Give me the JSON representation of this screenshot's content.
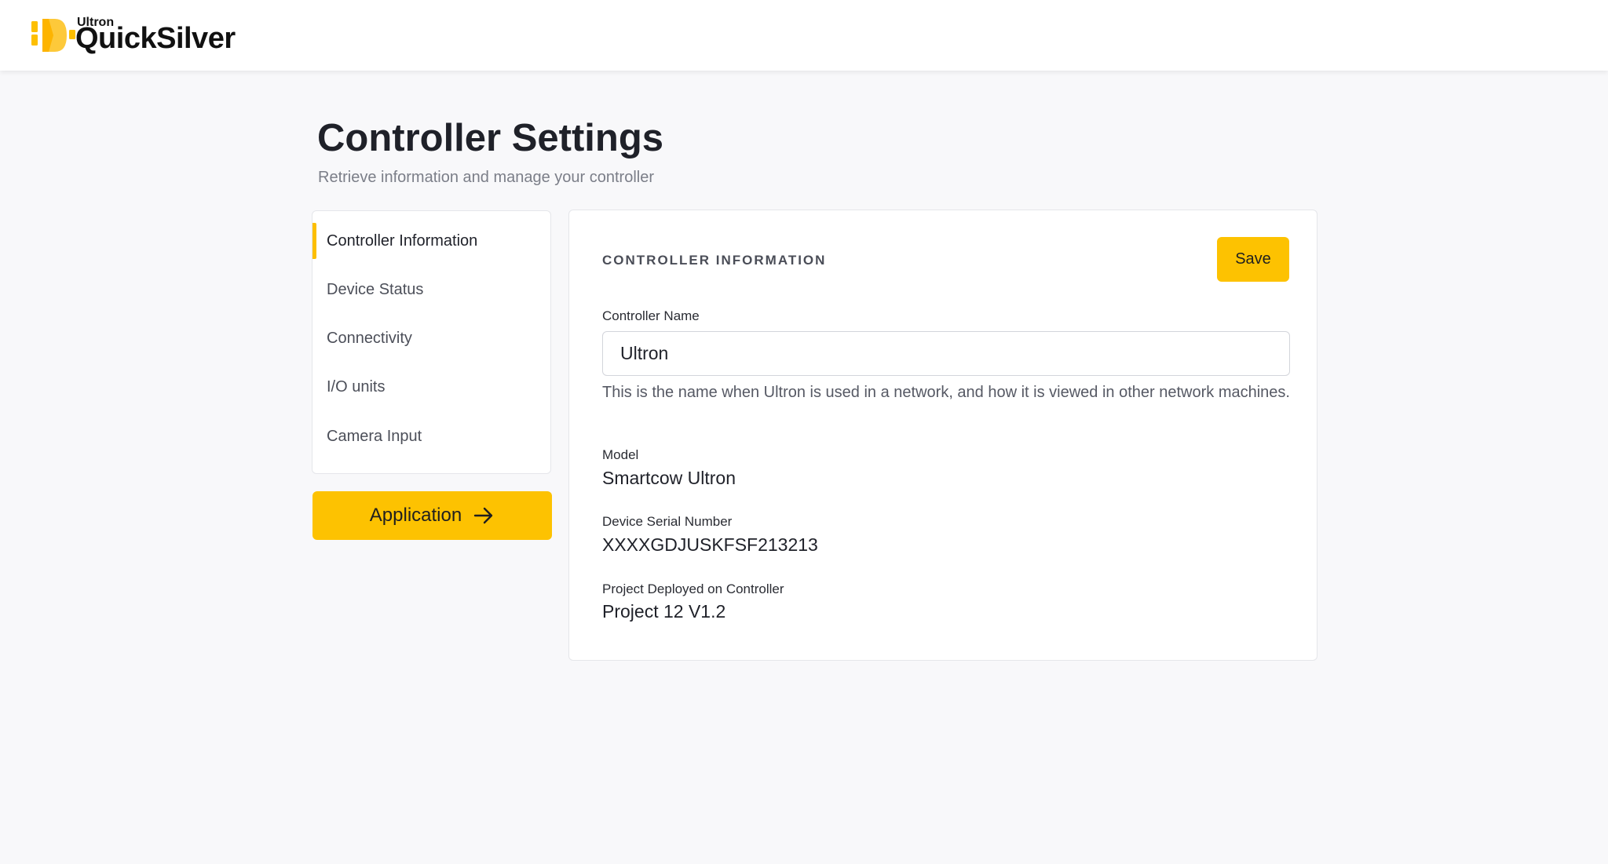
{
  "brand": {
    "small": "Ultron",
    "big": "QuickSilver",
    "accent": "#fdc201"
  },
  "page": {
    "title": "Controller Settings",
    "subtitle": "Retrieve information and manage your controller"
  },
  "sidebar": {
    "items": [
      {
        "label": "Controller Information",
        "active": true
      },
      {
        "label": "Device Status",
        "active": false
      },
      {
        "label": "Connectivity",
        "active": false
      },
      {
        "label": "I/O units",
        "active": false
      },
      {
        "label": "Camera Input",
        "active": false
      }
    ],
    "application_button": "Application"
  },
  "panel": {
    "section_title": "CONTROLLER INFORMATION",
    "save_label": "Save",
    "controller_name": {
      "label": "Controller Name",
      "value": "Ultron",
      "help": "This is the name when Ultron is used in a network, and how it is viewed in other network machines."
    },
    "model": {
      "label": "Model",
      "value": "Smartcow Ultron"
    },
    "serial": {
      "label": "Device Serial Number",
      "value": "XXXXGDJUSKFSF213213"
    },
    "project": {
      "label": "Project Deployed on Controller",
      "value": "Project 12 V1.2"
    }
  }
}
